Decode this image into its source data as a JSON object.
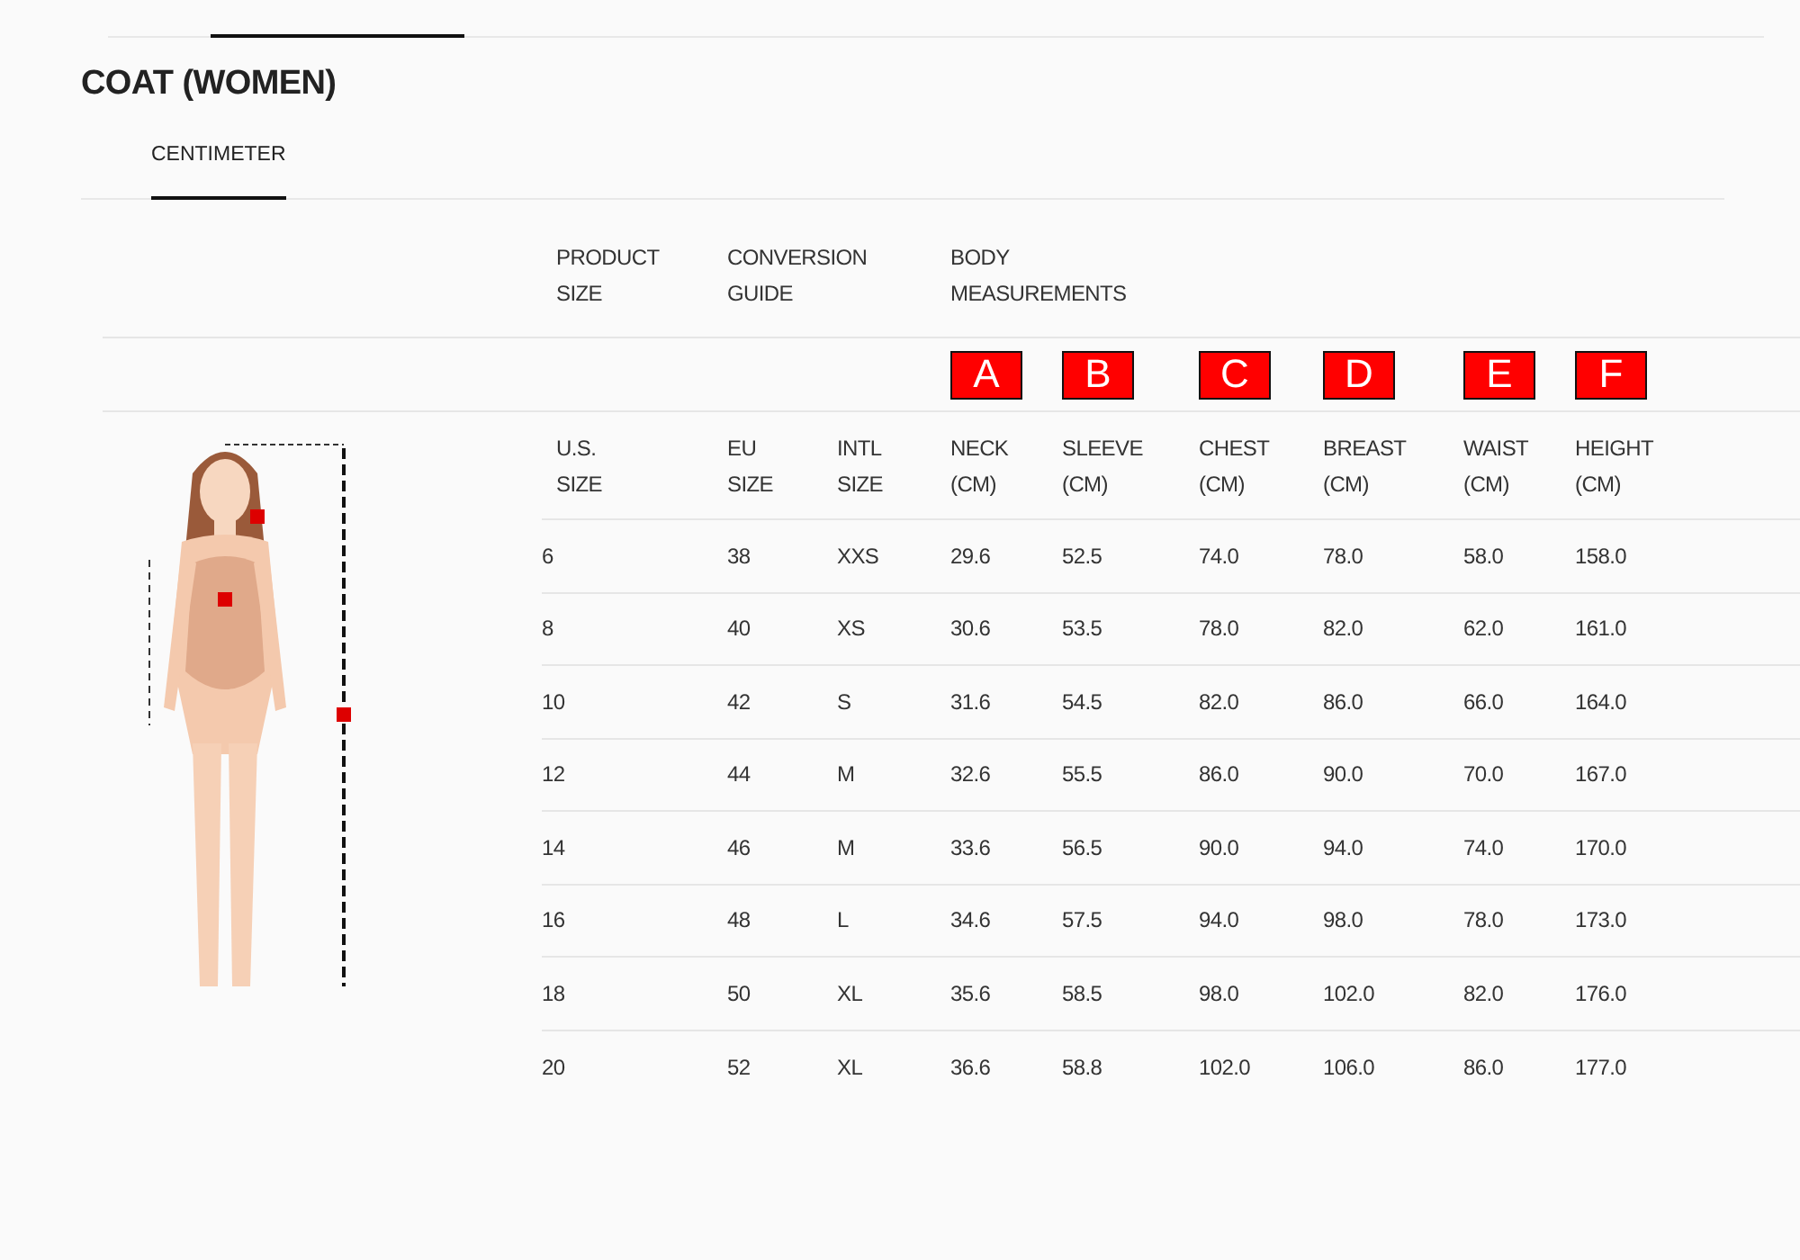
{
  "title": "COAT (WOMEN)",
  "tabs": [
    {
      "label": "CENTIMETER",
      "selected": true
    }
  ],
  "table": {
    "group_headers": [
      "PRODUCT SIZE",
      "CONVERSION GUIDE",
      "BODY MEASUREMENTS"
    ],
    "markers": [
      "A",
      "B",
      "C",
      "D",
      "E",
      "F"
    ],
    "columns": [
      "U.S. SIZE",
      "EU SIZE",
      "INTL SIZE",
      "NECK (CM)",
      "SLEEVE (CM)",
      "CHEST (CM)",
      "BREAST (CM)",
      "WAIST (CM)",
      "HEIGHT (CM)"
    ],
    "rows": [
      [
        "6",
        "38",
        "XXS",
        "29.6",
        "52.5",
        "74.0",
        "78.0",
        "58.0",
        "158.0"
      ],
      [
        "8",
        "40",
        "XS",
        "30.6",
        "53.5",
        "78.0",
        "82.0",
        "62.0",
        "161.0"
      ],
      [
        "10",
        "42",
        "S",
        "31.6",
        "54.5",
        "82.0",
        "86.0",
        "66.0",
        "164.0"
      ],
      [
        "12",
        "44",
        "M",
        "32.6",
        "55.5",
        "86.0",
        "90.0",
        "70.0",
        "167.0"
      ],
      [
        "14",
        "46",
        "M",
        "33.6",
        "56.5",
        "90.0",
        "94.0",
        "74.0",
        "170.0"
      ],
      [
        "16",
        "48",
        "L",
        "34.6",
        "57.5",
        "94.0",
        "98.0",
        "78.0",
        "173.0"
      ],
      [
        "18",
        "50",
        "XL",
        "35.6",
        "58.5",
        "98.0",
        "102.0",
        "82.0",
        "176.0"
      ],
      [
        "20",
        "52",
        "XL",
        "36.6",
        "58.8",
        "102.0",
        "106.0",
        "86.0",
        "177.0"
      ]
    ]
  }
}
